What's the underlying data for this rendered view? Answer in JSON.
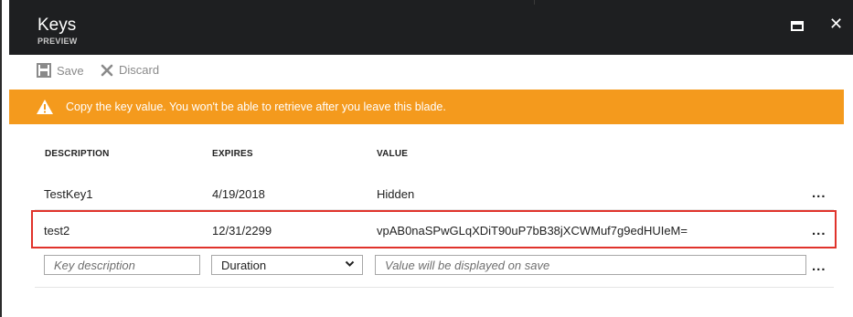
{
  "header": {
    "title": "Keys",
    "subtitle": "PREVIEW",
    "close_glyph": "✕"
  },
  "toolbar": {
    "save_label": "Save",
    "discard_label": "Discard"
  },
  "banner": {
    "message": "Copy the key value. You won't be able to retrieve after you leave this blade.",
    "color": "#f49a1d"
  },
  "table": {
    "columns": [
      "DESCRIPTION",
      "EXPIRES",
      "VALUE"
    ],
    "rows": [
      {
        "description": "TestKey1",
        "expires": "4/19/2018",
        "value": "Hidden",
        "menu": "..."
      },
      {
        "description": "test2",
        "expires": "12/31/2299",
        "value": "vpAB0naSPwGLqXDiT90uP7bB38jXCWMuf7g9edHUIeM=",
        "menu": "..."
      }
    ],
    "highlight_color": "#e0332b"
  },
  "new_row": {
    "description_placeholder": "Key description",
    "duration_value": "Duration",
    "value_placeholder": "Value will be displayed on save",
    "menu": "..."
  }
}
